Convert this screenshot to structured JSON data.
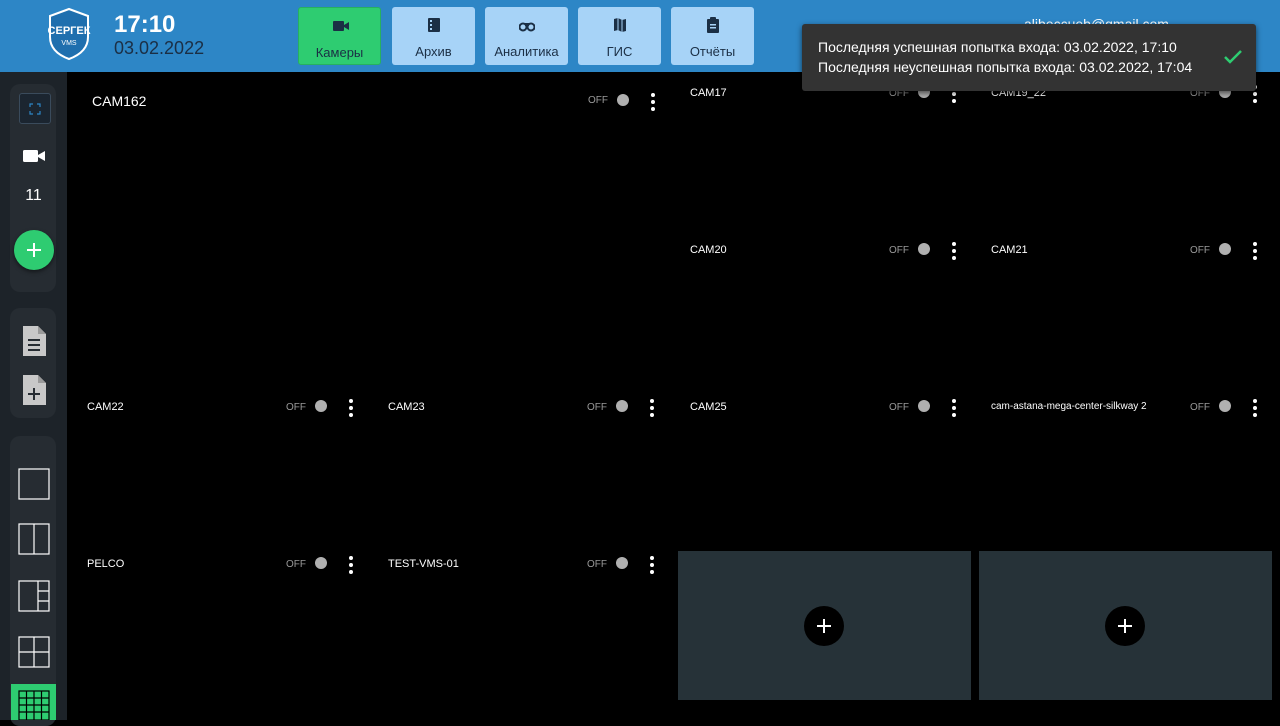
{
  "header": {
    "logo": {
      "line1": "СЕРГЕК",
      "line2": "VMS"
    },
    "time": "17:10",
    "date": "03.02.2022",
    "nav": [
      {
        "label": "Камеры",
        "icon": "video-camera-icon",
        "active": true
      },
      {
        "label": "Архив",
        "icon": "archive-film-icon",
        "active": false
      },
      {
        "label": "Аналитика",
        "icon": "binoculars-icon",
        "active": false
      },
      {
        "label": "ГИС",
        "icon": "map-icon",
        "active": false
      },
      {
        "label": "Отчёты",
        "icon": "clipboard-icon",
        "active": false
      }
    ],
    "user_email": "alibeccueb@gmail.com"
  },
  "toast": {
    "success_login": "Последняя успешная попытка входа: 03.02.2022, 17:10",
    "failed_login": "Последняя неуспешная попытка входа: 03.02.2022, 17:04",
    "icon": "check-icon"
  },
  "sidebar": {
    "camera_count": "11",
    "icons": [
      "fit-screen-icon",
      "video-camera-icon",
      "add-icon",
      "document-list-icon",
      "document-add-icon",
      "layout-1x1-icon",
      "layout-1x2-icon",
      "layout-1-plus-3-icon",
      "layout-2x2-icon",
      "layout-grid-icon"
    ],
    "accent": "#2ecc71"
  },
  "cameras": [
    {
      "name": "CAM162",
      "status": "OFF"
    },
    {
      "name": "CAM17",
      "status": "OFF"
    },
    {
      "name": "CAM19_22",
      "status": "OFF"
    },
    {
      "name": "CAM20",
      "status": "OFF"
    },
    {
      "name": "CAM21",
      "status": "OFF"
    },
    {
      "name": "CAM22",
      "status": "OFF"
    },
    {
      "name": "CAM23",
      "status": "OFF"
    },
    {
      "name": "CAM25",
      "status": "OFF"
    },
    {
      "name": "cam-astana-mega-center-silkway 2",
      "status": "OFF"
    },
    {
      "name": "PELCO",
      "status": "OFF"
    },
    {
      "name": "TEST-VMS-01",
      "status": "OFF"
    }
  ],
  "colors": {
    "header": "#2d86c6",
    "nav_button": "#a7d3f7",
    "active": "#2ecc71",
    "empty_slot": "#263238"
  }
}
